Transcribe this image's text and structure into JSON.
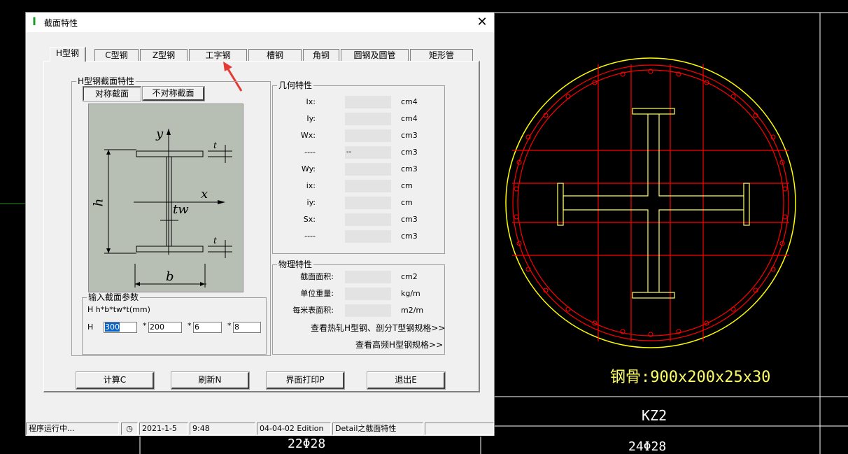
{
  "dialog": {
    "title": "截面特性",
    "title_icon": "I-beam-icon",
    "close_glyph": "✕"
  },
  "tabs": [
    {
      "label": "H型钢",
      "active": true
    },
    {
      "label": "C型钢"
    },
    {
      "label": "Z型钢"
    },
    {
      "label": "工字钢"
    },
    {
      "label": "槽钢"
    },
    {
      "label": "角钢"
    },
    {
      "label": "圆钢及圆管"
    },
    {
      "label": "矩形管"
    }
  ],
  "h_section": {
    "group_title": "H型钢截面特性",
    "symmetric_button": "对称截面",
    "asymmetric_button": "不对称截面",
    "diagram_labels": {
      "y": "y",
      "x": "x",
      "h": "h",
      "tw": "tw",
      "b": "b",
      "t1": "t",
      "t2": "t"
    }
  },
  "geometry": {
    "group_title": "几何特性",
    "rows": [
      {
        "label": "Ix:",
        "value": "",
        "unit": "cm4"
      },
      {
        "label": "Iy:",
        "value": "",
        "unit": "cm4"
      },
      {
        "label": "Wx:",
        "value": "",
        "unit": "cm3"
      },
      {
        "label": "----",
        "value": "--",
        "unit": "cm3"
      },
      {
        "label": "Wy:",
        "value": "",
        "unit": "cm3"
      },
      {
        "label": "ix:",
        "value": "",
        "unit": "cm"
      },
      {
        "label": "iy:",
        "value": "",
        "unit": "cm"
      },
      {
        "label": "Sx:",
        "value": "",
        "unit": "cm3"
      },
      {
        "label": "----",
        "value": "",
        "unit": "cm3"
      }
    ]
  },
  "physical": {
    "group_title": "物理特性",
    "rows": [
      {
        "label": "截面面积:",
        "value": "",
        "unit": "cm2"
      },
      {
        "label": "单位重量:",
        "value": "",
        "unit": "kg/m"
      },
      {
        "label": "每米表面积:",
        "value": "",
        "unit": "m2/m"
      }
    ],
    "link1": "查看热轧H型钢、剖分T型钢规格>>",
    "link2": "查看高频H型钢规格>>"
  },
  "input": {
    "group_title": "输入截面参数",
    "formula": "H   h*b*tw*t(mm)",
    "prefix": "H",
    "fields": [
      "300",
      "200",
      "6",
      "8"
    ],
    "star": "*"
  },
  "buttons": {
    "calc": "计算C",
    "refresh": "刷新N",
    "print": "界面打印P",
    "exit": "退出E"
  },
  "status": {
    "state": "程序运行中...",
    "date": "2021-1-5",
    "time": "9:48",
    "edition": "04-04-02 Edition",
    "module": "Detail之截面特性"
  },
  "cad": {
    "steel_label": "钢骨:900x200x25x30",
    "column_label": "KZ2",
    "rebar_left": "22Φ28",
    "rebar_right": "24Φ28"
  },
  "colors": {
    "accent_red": "#ff0000",
    "circle_yellow": "#ffff00",
    "arrow_red": "#e53935"
  }
}
